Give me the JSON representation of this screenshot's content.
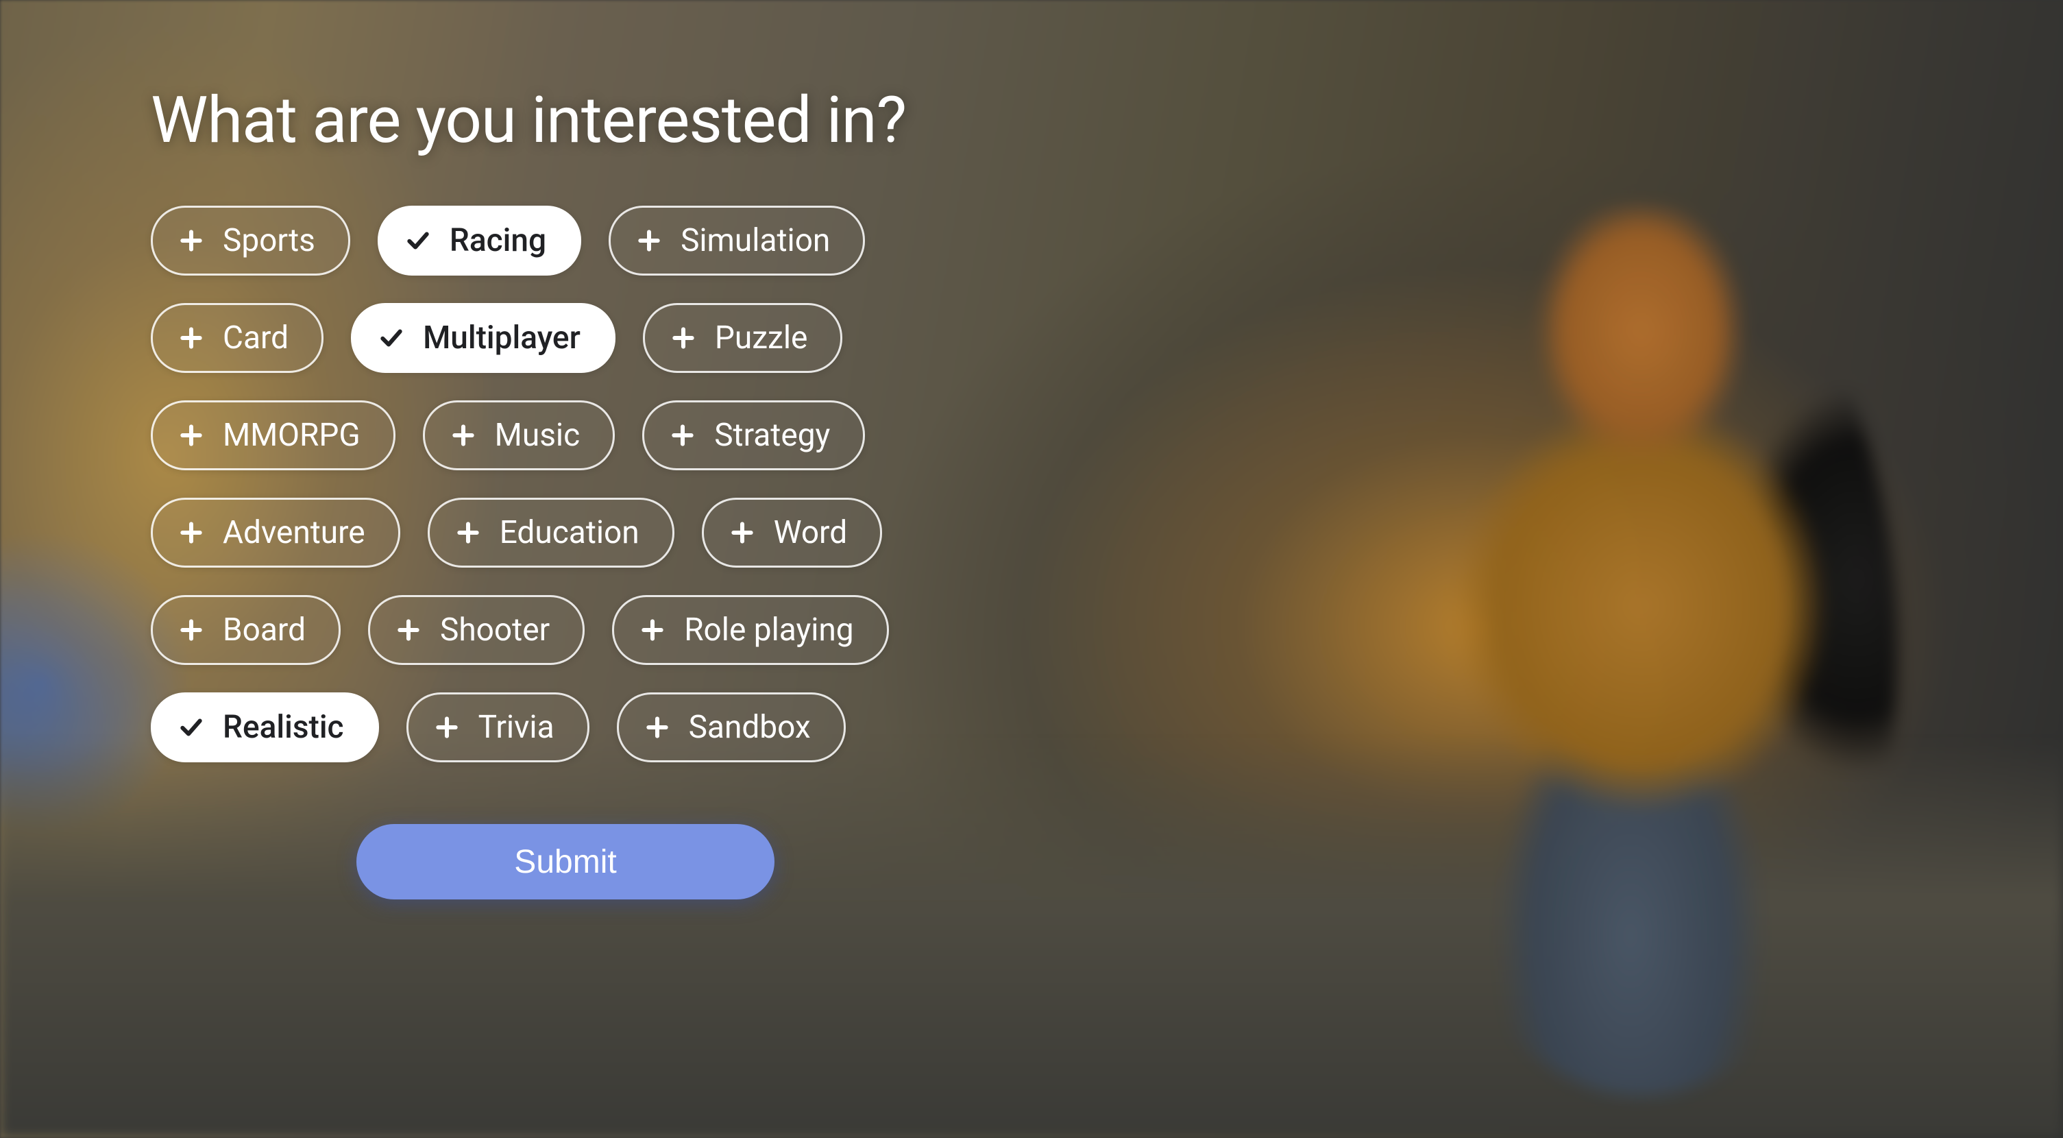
{
  "title": "What are you interested in?",
  "chips": [
    [
      {
        "label": "Sports",
        "selected": false
      },
      {
        "label": "Racing",
        "selected": true
      },
      {
        "label": "Simulation",
        "selected": false
      }
    ],
    [
      {
        "label": "Card",
        "selected": false
      },
      {
        "label": "Multiplayer",
        "selected": true
      },
      {
        "label": "Puzzle",
        "selected": false
      }
    ],
    [
      {
        "label": "MMORPG",
        "selected": false
      },
      {
        "label": "Music",
        "selected": false
      },
      {
        "label": "Strategy",
        "selected": false
      }
    ],
    [
      {
        "label": "Adventure",
        "selected": false
      },
      {
        "label": "Education",
        "selected": false
      },
      {
        "label": "Word",
        "selected": false
      }
    ],
    [
      {
        "label": "Board",
        "selected": false
      },
      {
        "label": "Shooter",
        "selected": false
      },
      {
        "label": "Role playing",
        "selected": false
      }
    ],
    [
      {
        "label": "Realistic",
        "selected": true
      },
      {
        "label": "Trivia",
        "selected": false
      },
      {
        "label": "Sandbox",
        "selected": false
      }
    ]
  ],
  "submit_label": "Submit",
  "colors": {
    "chip_border": "rgba(255,255,255,0.85)",
    "chip_selected_bg": "#ffffff",
    "chip_selected_fg": "#202124",
    "submit_bg": "#7a93e4",
    "submit_fg": "#ffffff"
  }
}
